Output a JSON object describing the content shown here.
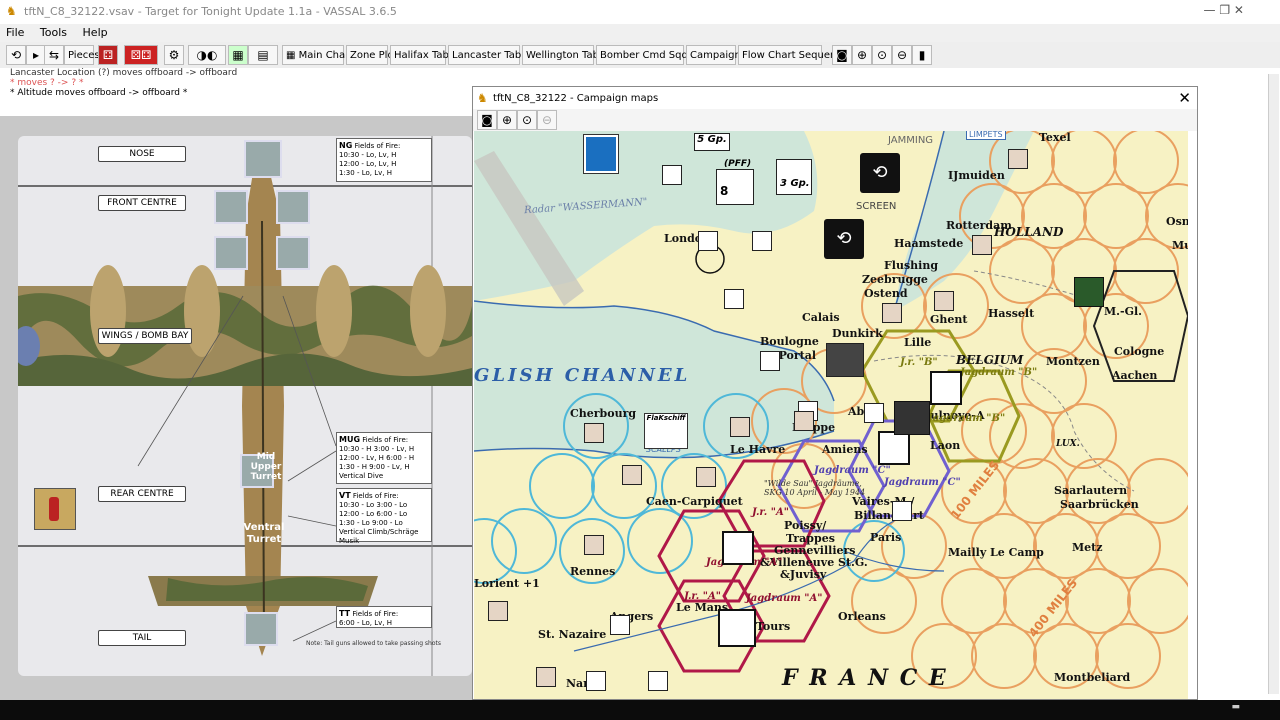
{
  "window": {
    "title": "tftN_C8_32122.vsav - Target for Tonight Update 1.1a - VASSAL 3.6.5",
    "controls": "— ❐ ✕"
  },
  "menu": {
    "file": "File",
    "tools": "Tools",
    "help": "Help"
  },
  "toolbar": {
    "pieces": "Pieces",
    "main_charts": "Main Charts",
    "zone_plot": "Zone Plot",
    "halifax": "Halifax Tables",
    "lancaster": "Lancaster Tables",
    "wellington": "Wellington Tables",
    "bomber_cmd": "Bomber Cmd Sqdrons",
    "campaigns": "Campaigns",
    "flow_chart": "Flow Chart Sequence"
  },
  "chat": [
    "Lancaster Location (?) moves offboard -> offboard",
    "* moves ? -> ? *",
    "* Altitude moves offboard -> offboard *"
  ],
  "bomber": {
    "positions": {
      "nose": "NOSE",
      "front_centre": "FRONT CENTRE",
      "wings": "WINGS / BOMB BAY",
      "rear_centre": "REAR CENTRE",
      "tail": "TAIL"
    },
    "turret_mid": "Mid Upper Turret",
    "turret_ventral": "Ventral Turret",
    "fields": {
      "ng": {
        "title": "NG",
        "sub": "Fields of Fire:",
        "lines": [
          "10:30 - Lo, Lv, H",
          "12:00 - Lo, Lv, H",
          "1:30 - Lo, Lv, H"
        ]
      },
      "mug": {
        "title": "MUG",
        "sub": "Fields of Fire:",
        "lines": [
          "10:30 - H      3:00 - Lv, H",
          "12:00 - Lv, H  6:00 - H",
          "1:30 - H       9:00 - Lv, H",
          "Vertical Dive"
        ]
      },
      "vt": {
        "title": "VT",
        "sub": "Fields of Fire:",
        "lines": [
          "10:30 - Lo     3:00 - Lo",
          "12:00 - Lo     6:00 - Lo",
          "1:30 - Lo      9:00 - Lo",
          "Vertical Climb/Schräge Musik"
        ]
      },
      "tt": {
        "title": "TT",
        "sub": "Fields of Fire:",
        "lines": [
          "6:00 - Lo, Lv, H"
        ]
      }
    },
    "note": "Note: Tail guns allowed to take passing shots"
  },
  "mapwin": {
    "title": "tftN_C8_32122 - Campaign maps",
    "close": "✕"
  },
  "map": {
    "sea": "GLISH   CHANNEL",
    "france": "F  R  A  N  C  E",
    "holland": "HOLLAND",
    "belgium": "BELGIUM",
    "wassermann": "Radar \"WASSERMANN\"",
    "jamming": "JAMMING",
    "screen": "SCREEN",
    "limpets": "LIMPETS",
    "pff": "(PFF)",
    "gp5": "5 Gp.",
    "gp3": "3 Gp.",
    "gp8": "8",
    "miles_a": "100 MILES",
    "miles_b": "400 MILES",
    "places": {
      "texel": "Texel",
      "ijmuiden": "IJmuiden",
      "rotterdam": "Rotterdam",
      "haamstede": "Haamstede",
      "london": "London",
      "flushing": "Flushing",
      "zeebrugge": "Zeebrugge",
      "ostend": "Ostend",
      "calais": "Calais",
      "dunkirk": "Dunkirk",
      "boulogne": "Boulogne",
      "leportal": "Le Portal",
      "lille": "Lille",
      "ghent": "Ghent",
      "hasselt": "Hasselt",
      "montzen": "Montzen",
      "aachen": "Aachen",
      "cologne": "Cologne",
      "mgl": "M.-Gl.",
      "osn": "Osn",
      "mu": "Mu",
      "cherbourg": "Cherbourg",
      "dieppe": "Dieppe",
      "abbeville": "Abb",
      "amiens": "Amiens",
      "aulnoye": "Aulnoye-A",
      "laon": "Laon",
      "lehavre": "Le Havre",
      "caen": "Caen-Carpiquet",
      "vaires": "Vaires-M./",
      "billancourt": "Billancourt",
      "poissy": "Poissy/",
      "trappes": "Trappes",
      "gennevilliers": "Gennevilliers",
      "villeneuve": "&Villeneuve St.G.",
      "juvisy": "&Juvisy",
      "paris": "Paris",
      "rennes": "Rennes",
      "lorient": "Lorient +1",
      "lemans": "Le Mans",
      "angers": "Angers",
      "tours": "Tours",
      "orleans": "Orleans",
      "stnazaire": "St. Nazaire",
      "nantes": "Nant",
      "maillylecamp": "Mailly Le Camp",
      "metz": "Metz",
      "saarlautern": "Saarlautern",
      "saarbrucken": "Saarbrücken",
      "montbeliard": "Montbeliard",
      "lux": "LUX."
    },
    "zones": {
      "jg_b1": "Jagdraum \"B\"",
      "jg_b2": "Jagdraum \"B\"",
      "jr_b": "J.r. \"B\"",
      "jg_c1": "Jagdraum \"C\"",
      "jg_c2": "Jagdraum \"C\"",
      "jg_a1": "Jagdraum \"A\"",
      "jg_a2": "Jagdraum \"A\"",
      "jr_a1": "J.r. \"A\"",
      "jr_a2": "J.r. \"A\"",
      "wildesau": "\"Wilde Sau\" Jagdräume, SKG 10 April - May 1944",
      "scallps": "SCALLPS",
      "flakschiff": "FlaKschiff"
    }
  }
}
